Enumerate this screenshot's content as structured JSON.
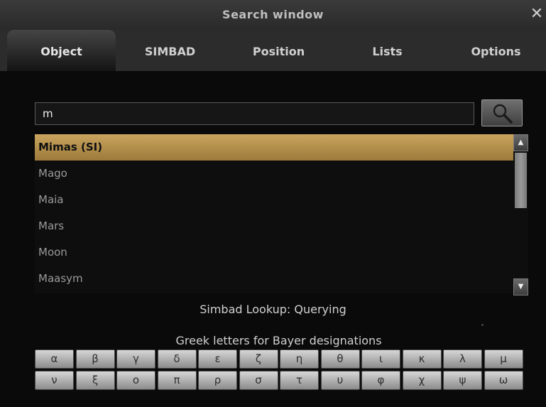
{
  "window": {
    "title": "Search window",
    "close_glyph": "✕"
  },
  "tabs": [
    {
      "label": "Object",
      "active": true
    },
    {
      "label": "SIMBAD",
      "active": false
    },
    {
      "label": "Position",
      "active": false
    },
    {
      "label": "Lists",
      "active": false
    },
    {
      "label": "Options",
      "active": false
    }
  ],
  "search": {
    "value": "m",
    "button_icon": "search-icon"
  },
  "results": [
    {
      "label": "Mimas (SI)",
      "selected": true
    },
    {
      "label": "Mago",
      "selected": false
    },
    {
      "label": "Maia",
      "selected": false
    },
    {
      "label": "Mars",
      "selected": false
    },
    {
      "label": "Moon",
      "selected": false
    },
    {
      "label": "Maasym",
      "selected": false
    }
  ],
  "scrollbar": {
    "up_glyph": "▲",
    "down_glyph": "▼"
  },
  "status_text": "Simbad Lookup: Querying",
  "greek": {
    "label": "Greek letters for Bayer designations",
    "row1": [
      "α",
      "β",
      "γ",
      "δ",
      "ε",
      "ζ",
      "η",
      "θ",
      "ι",
      "κ",
      "λ",
      "μ"
    ],
    "row2": [
      "ν",
      "ξ",
      "ο",
      "π",
      "ρ",
      "σ",
      "τ",
      "υ",
      "φ",
      "χ",
      "ψ",
      "ω"
    ]
  },
  "colors": {
    "selected_bg": "#b8944f",
    "background": "#0a0a0a"
  }
}
